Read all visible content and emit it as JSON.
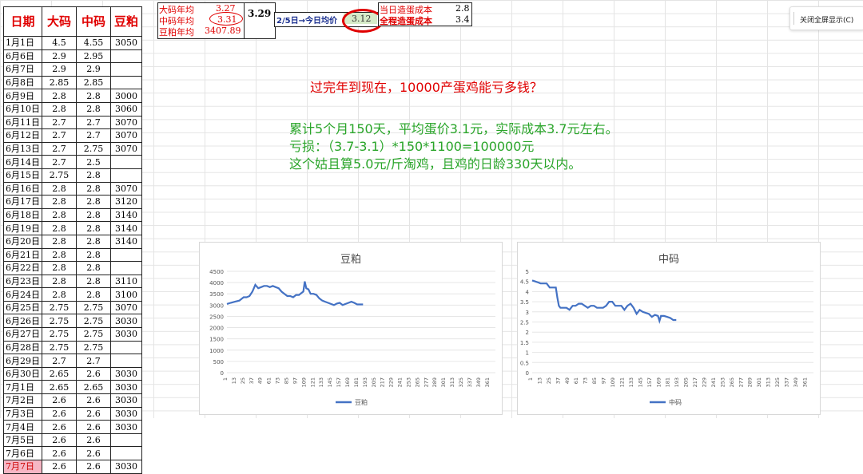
{
  "table": {
    "headers": [
      "日期",
      "大码",
      "中码",
      "豆粕"
    ],
    "rows": [
      [
        "1月1日",
        "4.5",
        "4.55",
        "3050"
      ],
      [
        "6月6日",
        "2.9",
        "2.95",
        ""
      ],
      [
        "6月7日",
        "2.9",
        "2.9",
        ""
      ],
      [
        "6月8日",
        "2.85",
        "2.85",
        ""
      ],
      [
        "6月9日",
        "2.8",
        "2.8",
        "3000"
      ],
      [
        "6月10日",
        "2.8",
        "2.8",
        "3060"
      ],
      [
        "6月11日",
        "2.7",
        "2.7",
        "3070"
      ],
      [
        "6月12日",
        "2.7",
        "2.7",
        "3070"
      ],
      [
        "6月13日",
        "2.7",
        "2.75",
        "3070"
      ],
      [
        "6月14日",
        "2.7",
        "2.5",
        ""
      ],
      [
        "6月15日",
        "2.75",
        "2.8",
        ""
      ],
      [
        "6月16日",
        "2.8",
        "2.8",
        "3070"
      ],
      [
        "6月17日",
        "2.8",
        "2.8",
        "3120"
      ],
      [
        "6月18日",
        "2.8",
        "2.8",
        "3140"
      ],
      [
        "6月19日",
        "2.8",
        "2.8",
        "3140"
      ],
      [
        "6月20日",
        "2.8",
        "2.8",
        "3140"
      ],
      [
        "6月21日",
        "2.8",
        "2.8",
        ""
      ],
      [
        "6月22日",
        "2.8",
        "2.8",
        ""
      ],
      [
        "6月23日",
        "2.8",
        "2.8",
        "3110"
      ],
      [
        "6月24日",
        "2.8",
        "2.8",
        "3100"
      ],
      [
        "6月25日",
        "2.75",
        "2.75",
        "3070"
      ],
      [
        "6月26日",
        "2.75",
        "2.75",
        "3030"
      ],
      [
        "6月27日",
        "2.75",
        "2.75",
        "3030"
      ],
      [
        "6月28日",
        "2.75",
        "2.75",
        ""
      ],
      [
        "6月29日",
        "2.7",
        "2.7",
        ""
      ],
      [
        "6月30日",
        "2.65",
        "2.6",
        "3030"
      ],
      [
        "7月1日",
        "2.65",
        "2.65",
        "3030"
      ],
      [
        "7月2日",
        "2.6",
        "2.6",
        "3030"
      ],
      [
        "7月3日",
        "2.6",
        "2.6",
        "3030"
      ],
      [
        "7月4日",
        "2.6",
        "2.6",
        "3030"
      ],
      [
        "7月5日",
        "2.6",
        "2.6",
        ""
      ],
      [
        "7月6日",
        "2.6",
        "2.6",
        ""
      ],
      [
        "7月7日",
        "2.6",
        "2.6",
        "3030"
      ]
    ]
  },
  "stats": {
    "large_avg_label": "大码年均",
    "large_avg": "3.27",
    "mid_avg_label": "中码年均",
    "mid_avg": "3.31",
    "soy_avg_label": "豆粕年均",
    "soy_avg": "3407.89",
    "combined": "3.29",
    "since_label": "2/5日→今日均价",
    "since_value": "3.12",
    "cost_today_label": "当日造蛋成本",
    "cost_today": "2.8",
    "cost_total_label": "全程造蛋成本",
    "cost_total": "3.4"
  },
  "notes": {
    "question": "过完年到现在，10000产蛋鸡能亏多钱？",
    "line1": "累计5个月150天，平均蛋价3.1元，实际成本3.7元左右。",
    "line2": "亏损：（3.7-3.1）*150*1100=100000元",
    "line3": "这个姑且算5.0元/斤淘鸡，且鸡的日龄330天以内。"
  },
  "popup": {
    "label": "关闭全屏显示(C)"
  },
  "colors": {
    "accent_red": "#e00000",
    "note_green": "#2aa52a",
    "line_blue": "#4472c4"
  },
  "chart_data": [
    {
      "type": "line",
      "title": "豆粕",
      "ylim": [
        0,
        4500
      ],
      "yticks": [
        "0",
        "500",
        "1000",
        "1500",
        "2000",
        "2500",
        "3000",
        "3500",
        "4000",
        "4500"
      ],
      "xticks": [
        "1",
        "13",
        "25",
        "37",
        "49",
        "61",
        "73",
        "85",
        "97",
        "109",
        "121",
        "133",
        "145",
        "157",
        "169",
        "181",
        "193",
        "205",
        "217",
        "229",
        "241",
        "253",
        "265",
        "277",
        "289",
        "301",
        "313",
        "325",
        "337",
        "349",
        "361"
      ],
      "xmax": 370,
      "series": [
        {
          "name": "豆粕",
          "x": [
            1,
            6,
            12,
            18,
            24,
            28,
            32,
            36,
            40,
            44,
            48,
            52,
            56,
            60,
            64,
            68,
            72,
            76,
            80,
            84,
            88,
            92,
            96,
            100,
            104,
            106,
            108,
            110,
            113,
            116,
            120,
            124,
            128,
            132,
            136,
            140,
            144,
            148,
            152,
            156,
            160,
            164,
            168,
            172,
            176,
            180,
            184,
            188
          ],
          "y": [
            3050,
            3100,
            3150,
            3200,
            3350,
            3350,
            3400,
            3600,
            3900,
            3750,
            3800,
            3850,
            3850,
            3800,
            3850,
            3800,
            3750,
            3600,
            3500,
            3400,
            3400,
            3350,
            3450,
            3450,
            3550,
            3600,
            4050,
            3750,
            3700,
            3500,
            3500,
            3450,
            3300,
            3200,
            3150,
            3100,
            3050,
            3000,
            3070,
            3100,
            3000,
            3050,
            3100,
            3150,
            3100,
            3030,
            3030,
            3030
          ]
        }
      ]
    },
    {
      "type": "line",
      "title": "中码",
      "ylim": [
        0,
        5
      ],
      "yticks": [
        "0",
        "0.5",
        "1",
        "1.5",
        "2",
        "2.5",
        "3",
        "3.5",
        "4",
        "4.5",
        "5"
      ],
      "xticks": [
        "1",
        "13",
        "25",
        "37",
        "49",
        "61",
        "73",
        "85",
        "97",
        "109",
        "121",
        "133",
        "145",
        "157",
        "169",
        "181",
        "193",
        "205",
        "217",
        "229",
        "241",
        "253",
        "265",
        "277",
        "289",
        "301",
        "313",
        "325",
        "337",
        "349",
        "361"
      ],
      "xmax": 370,
      "series": [
        {
          "name": "中码",
          "x": [
            1,
            5,
            9,
            12,
            16,
            20,
            24,
            28,
            32,
            34,
            36,
            38,
            42,
            46,
            50,
            54,
            58,
            62,
            66,
            70,
            74,
            78,
            82,
            86,
            90,
            94,
            98,
            102,
            106,
            110,
            114,
            118,
            122,
            126,
            130,
            134,
            138,
            142,
            146,
            150,
            154,
            158,
            162,
            166,
            168,
            170,
            174,
            178,
            182,
            186,
            190
          ],
          "y": [
            4.55,
            4.5,
            4.45,
            4.4,
            4.4,
            4.4,
            4.2,
            4.2,
            4.2,
            3.7,
            3.3,
            3.2,
            3.2,
            3.2,
            3.1,
            3.3,
            3.3,
            3.4,
            3.4,
            3.3,
            3.2,
            3.3,
            3.3,
            3.2,
            3.2,
            3.2,
            3.3,
            3.5,
            3.5,
            3.3,
            3.3,
            3.3,
            3.1,
            3.3,
            3.4,
            3.2,
            2.9,
            3.1,
            3.0,
            2.95,
            2.9,
            2.75,
            2.85,
            2.8,
            2.55,
            2.8,
            2.8,
            2.75,
            2.7,
            2.6,
            2.6
          ]
        }
      ]
    }
  ]
}
